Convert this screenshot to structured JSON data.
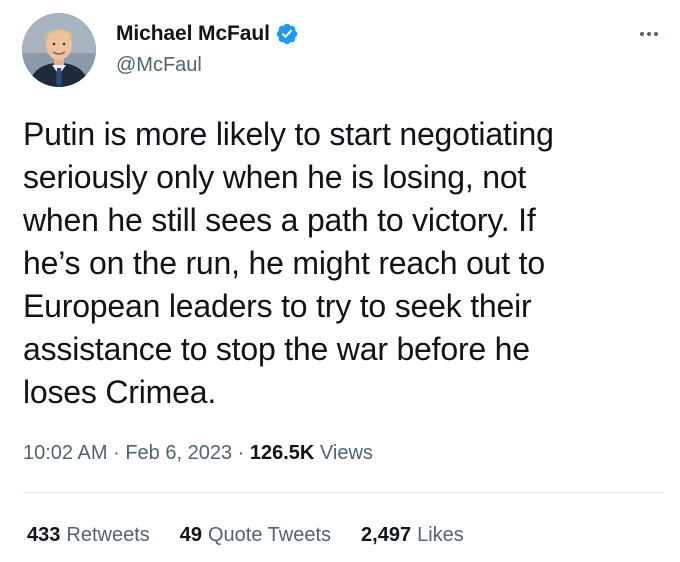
{
  "author": {
    "display_name": "Michael McFaul",
    "handle": "@McFaul",
    "verified": true,
    "verified_color": "#1d9bf0"
  },
  "more_icon": "more-horizontal-icon",
  "tweet": {
    "text_lines": [
      "Putin is more likely to start negotiating",
      "seriously only when he is losing, not",
      "when he still sees a path to victory. If",
      "he’s on the run, he might reach out to",
      "European leaders to try to seek their",
      "assistance to stop the war before he",
      "loses Crimea."
    ]
  },
  "meta": {
    "time": "10:02 AM",
    "separator": "·",
    "date": "Feb 6, 2023",
    "views_count": "126.5K",
    "views_label": "Views"
  },
  "stats": {
    "retweets_count": "433",
    "retweets_label": "Retweets",
    "quotes_count": "49",
    "quotes_label": "Quote Tweets",
    "likes_count": "2,497",
    "likes_label": "Likes"
  },
  "colors": {
    "text_primary": "#0f1419",
    "text_secondary": "#536471",
    "divider": "#e6ecf0"
  }
}
